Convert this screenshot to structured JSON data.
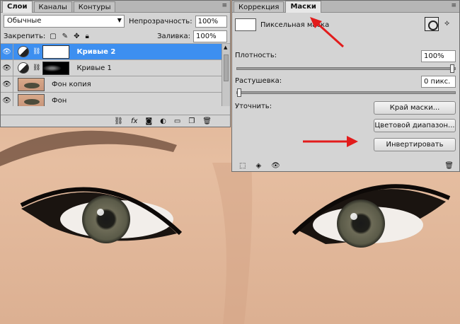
{
  "layers_panel": {
    "tabs": [
      "Слои",
      "Каналы",
      "Контуры"
    ],
    "active_tab": 0,
    "blend_mode": "Обычные",
    "opacity_label": "Непрозрачность:",
    "opacity_value": "100%",
    "lock_label": "Закрепить:",
    "fill_label": "Заливка:",
    "fill_value": "100%",
    "layers": [
      {
        "name": "Кривые 2",
        "kind": "adjustment",
        "mask": "white",
        "selected": true
      },
      {
        "name": "Кривые 1",
        "kind": "adjustment",
        "mask": "dark",
        "selected": false
      },
      {
        "name": "Фон копия",
        "kind": "image",
        "selected": false
      },
      {
        "name": "Фон",
        "kind": "image",
        "selected": false
      }
    ]
  },
  "masks_panel": {
    "tabs": [
      "Коррекция",
      "Маски"
    ],
    "active_tab": 1,
    "mask_type": "Пиксельная маска",
    "density_label": "Плотность:",
    "density_value": "100%",
    "density_fraction": 1.0,
    "feather_label": "Растушевка:",
    "feather_value": "0 пикс.",
    "feather_fraction": 0.0,
    "refine_label": "Уточнить:",
    "buttons": {
      "mask_edge": "Край маски...",
      "color_range": "Цветовой диапазон...",
      "invert": "Инвертировать"
    }
  },
  "colors": {
    "selection": "#3d8ff0",
    "arrow": "#e21c1c",
    "skin": "#e3b99a"
  }
}
